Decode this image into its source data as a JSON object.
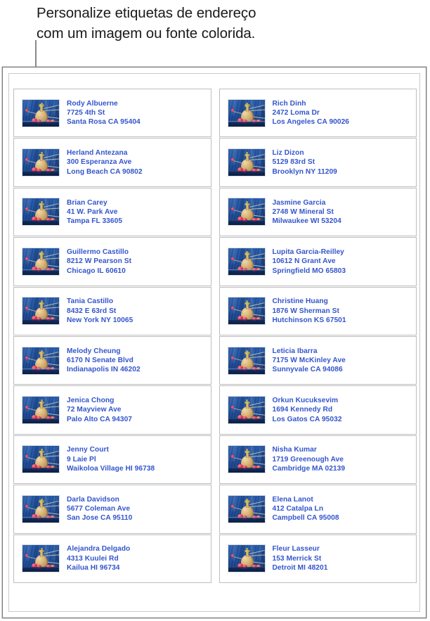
{
  "caption": {
    "text": "Personalize etiquetas de endereço\ncom um imagem ou fonte colorida."
  },
  "colors": {
    "address_text": "#3355CC",
    "caption_text": "#1A1A1A",
    "cell_border": "#BDBDBD",
    "sheet_border": "#7B7B7B",
    "callout_line": "#8A8A8A",
    "thumbnail_background": "#1F4F9D"
  },
  "thumbnail": {
    "icon_name": "perfume-bottle-photo",
    "description": "perfume bottle with flowers on blue denim background"
  },
  "labels": {
    "left_column": [
      {
        "name": "Rody Albuerne",
        "street": "7725 4th St",
        "city": "Santa Rosa CA 95404"
      },
      {
        "name": "Herland Antezana",
        "street": "300 Esperanza Ave",
        "city": "Long Beach CA 90802"
      },
      {
        "name": "Brian Carey",
        "street": "41 W. Park Ave",
        "city": "Tampa FL 33605"
      },
      {
        "name": "Guillermo Castillo",
        "street": "8212 W Pearson St",
        "city": "Chicago IL 60610"
      },
      {
        "name": "Tania Castillo",
        "street": "8432 E 63rd St",
        "city": "New York NY 10065"
      },
      {
        "name": "Melody Cheung",
        "street": "6170 N Senate Blvd",
        "city": "Indianapolis IN 46202"
      },
      {
        "name": "Jenica Chong",
        "street": "72 Mayview Ave",
        "city": "Palo Alto CA 94307"
      },
      {
        "name": "Jenny Court",
        "street": "9 Laie Pl",
        "city": "Waikoloa Village HI 96738"
      },
      {
        "name": "Darla Davidson",
        "street": "5677 Coleman Ave",
        "city": "San Jose CA 95110"
      },
      {
        "name": "Alejandra Delgado",
        "street": "4313 Kuulei Rd",
        "city": "Kailua HI 96734"
      }
    ],
    "right_column": [
      {
        "name": "Rich Dinh",
        "street": "2472 Loma Dr",
        "city": "Los Angeles CA 90026"
      },
      {
        "name": "Liz Dizon",
        "street": "5129 83rd St",
        "city": "Brooklyn NY 11209"
      },
      {
        "name": "Jasmine Garcia",
        "street": "2748 W Mineral St",
        "city": "Milwaukee WI 53204"
      },
      {
        "name": "Lupita Garcia-Reilley",
        "street": "10612 N Grant Ave",
        "city": "Springfield MO 65803"
      },
      {
        "name": "Christine Huang",
        "street": "1876 W Sherman St",
        "city": "Hutchinson KS 67501"
      },
      {
        "name": "Leticia Ibarra",
        "street": "7175 W McKinley Ave",
        "city": "Sunnyvale CA 94086"
      },
      {
        "name": "Orkun Kucuksevim",
        "street": "1694 Kennedy Rd",
        "city": "Los Gatos CA 95032"
      },
      {
        "name": "Nisha Kumar",
        "street": "1719 Greenough Ave",
        "city": "Cambridge MA 02139"
      },
      {
        "name": "Elena Lanot",
        "street": "412 Catalpa Ln",
        "city": "Campbell CA 95008"
      },
      {
        "name": "Fleur Lasseur",
        "street": "153 Merrick St",
        "city": "Detroit MI 48201"
      }
    ]
  }
}
